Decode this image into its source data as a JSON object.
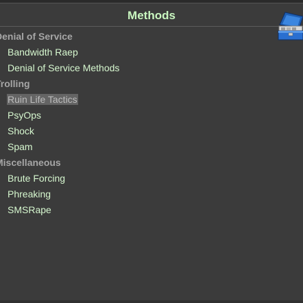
{
  "header": {
    "title": "Methods",
    "icon": "toolbox-icon"
  },
  "tree": {
    "groups": [
      {
        "label": "Denial of Service",
        "items": [
          {
            "label": "Bandwidth Raep",
            "selected": false
          },
          {
            "label": "Denial of Service Methods",
            "selected": false
          }
        ]
      },
      {
        "label": "Trolling",
        "items": [
          {
            "label": "Ruin Life Tactics",
            "selected": true
          },
          {
            "label": "PsyOps",
            "selected": false
          },
          {
            "label": "Shock",
            "selected": false
          },
          {
            "label": "Spam",
            "selected": false
          }
        ]
      },
      {
        "label": "Miscellaneous",
        "items": [
          {
            "label": "Brute Forcing",
            "selected": false
          },
          {
            "label": "Phreaking",
            "selected": false
          },
          {
            "label": "SMSRape",
            "selected": false
          }
        ]
      }
    ]
  },
  "colors": {
    "background": "#3b3b3b",
    "title": "#c9f7c0",
    "item_text": "#d6f7cf",
    "category_text": "#a6a6a6",
    "selection": "#646464"
  }
}
